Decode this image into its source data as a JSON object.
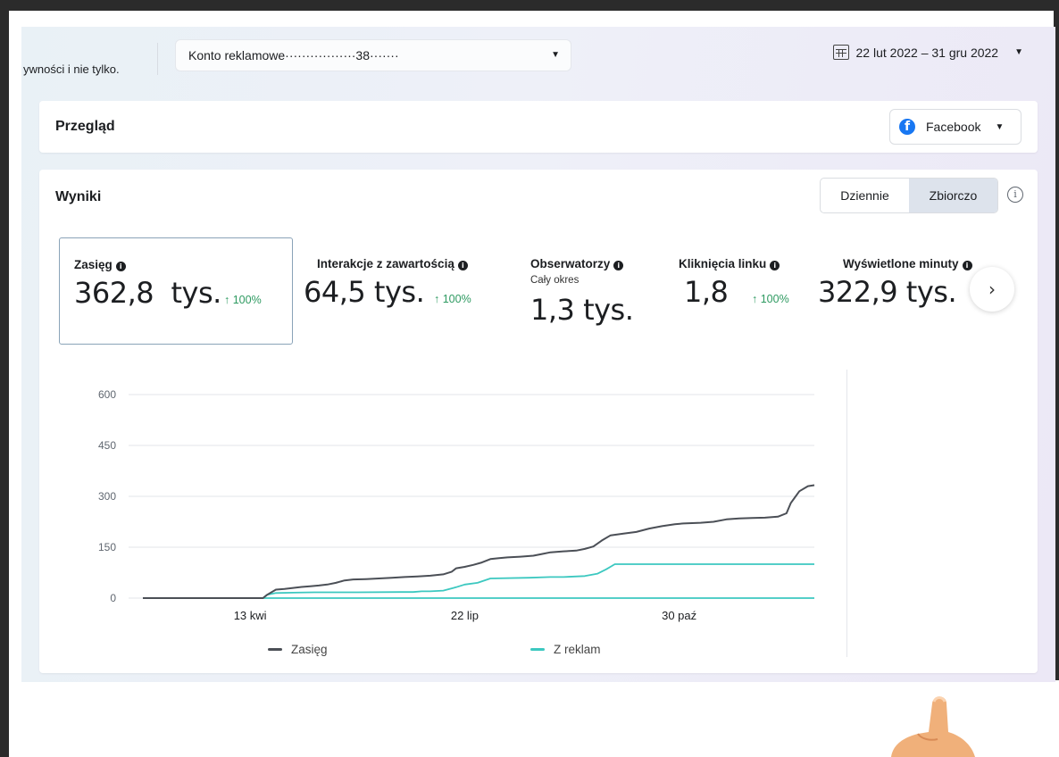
{
  "topbar": {
    "left_text": "ywności i nie tylko.",
    "account_label": "Konto reklamowe",
    "account_id": "·················38·······",
    "date_range": "22 lut 2022 – 31 gru 2022"
  },
  "overview": {
    "title": "Przegląd",
    "platform": "Facebook"
  },
  "results": {
    "title": "Wyniki",
    "toggle_daily": "Dziennie",
    "toggle_cumulative": "Zbiorczo",
    "info_glyph": "i",
    "next_glyph": "›"
  },
  "metrics": [
    {
      "label": "Zasięg",
      "value": "362,8",
      "unit": "tys.",
      "change": "↑ 100%",
      "selected": true
    },
    {
      "label": "Interakcje z zawartością",
      "value": "64,5",
      "unit": "tys.",
      "change": "↑ 100%"
    },
    {
      "label": "Obserwatorzy",
      "sub": "Cały okres",
      "value": "1,3",
      "unit": "tys."
    },
    {
      "label": "Kliknięcia linku",
      "value": "1,8",
      "change": "↑ 100%"
    },
    {
      "label": "Wyświetlone minuty",
      "value": "322,9",
      "unit": "tys.",
      "change": "↑"
    }
  ],
  "colors": {
    "zasieg_line": "#4b4f56",
    "reklam_line": "#3cc8c0",
    "positive": "#2e9a61",
    "selected_border": "#8aa3b8"
  },
  "chart_data": {
    "type": "line",
    "title": "",
    "xlabel": "",
    "ylabel": "",
    "ylim": [
      0,
      600
    ],
    "yticks": [
      0,
      150,
      300,
      450,
      600
    ],
    "xticks": [
      "13 kwi",
      "22 lip",
      "30 paź"
    ],
    "xtick_days": [
      50,
      150,
      250
    ],
    "xlim_days": [
      0,
      313
    ],
    "grid": true,
    "legend_position": "bottom",
    "series": [
      {
        "name": "Zasięg",
        "x": [
          0,
          56,
          58,
          62,
          66,
          70,
          74,
          78,
          82,
          86,
          90,
          94,
          98,
          104,
          110,
          116,
          122,
          128,
          134,
          140,
          144,
          146,
          150,
          154,
          158,
          162,
          166,
          170,
          176,
          182,
          186,
          190,
          196,
          202,
          206,
          210,
          214,
          218,
          224,
          230,
          236,
          242,
          248,
          252,
          256,
          260,
          266,
          272,
          278,
          284,
          290,
          296,
          300,
          302,
          306,
          310,
          313
        ],
        "y": [
          0,
          0,
          10,
          25,
          27,
          30,
          33,
          35,
          37,
          40,
          45,
          52,
          55,
          56,
          58,
          60,
          62,
          64,
          66,
          70,
          78,
          88,
          92,
          98,
          105,
          115,
          118,
          120,
          122,
          125,
          130,
          135,
          138,
          140,
          145,
          152,
          170,
          185,
          190,
          195,
          205,
          212,
          218,
          220,
          221,
          222,
          225,
          232,
          235,
          236,
          237,
          240,
          250,
          280,
          315,
          330,
          333
        ]
      },
      {
        "name": "Z reklam",
        "x": [
          0,
          56,
          58,
          62,
          70,
          80,
          100,
          120,
          126,
          130,
          134,
          140,
          146,
          150,
          156,
          162,
          180,
          190,
          196,
          206,
          212,
          216,
          220,
          240,
          280,
          313
        ],
        "y": [
          0,
          0,
          10,
          15,
          16,
          17,
          17,
          18,
          18,
          20,
          20,
          22,
          32,
          40,
          45,
          58,
          60,
          62,
          62,
          65,
          72,
          85,
          100,
          100,
          100,
          100
        ]
      },
      {
        "name": "",
        "x": [
          0,
          313
        ],
        "y": [
          0,
          0
        ]
      }
    ]
  }
}
